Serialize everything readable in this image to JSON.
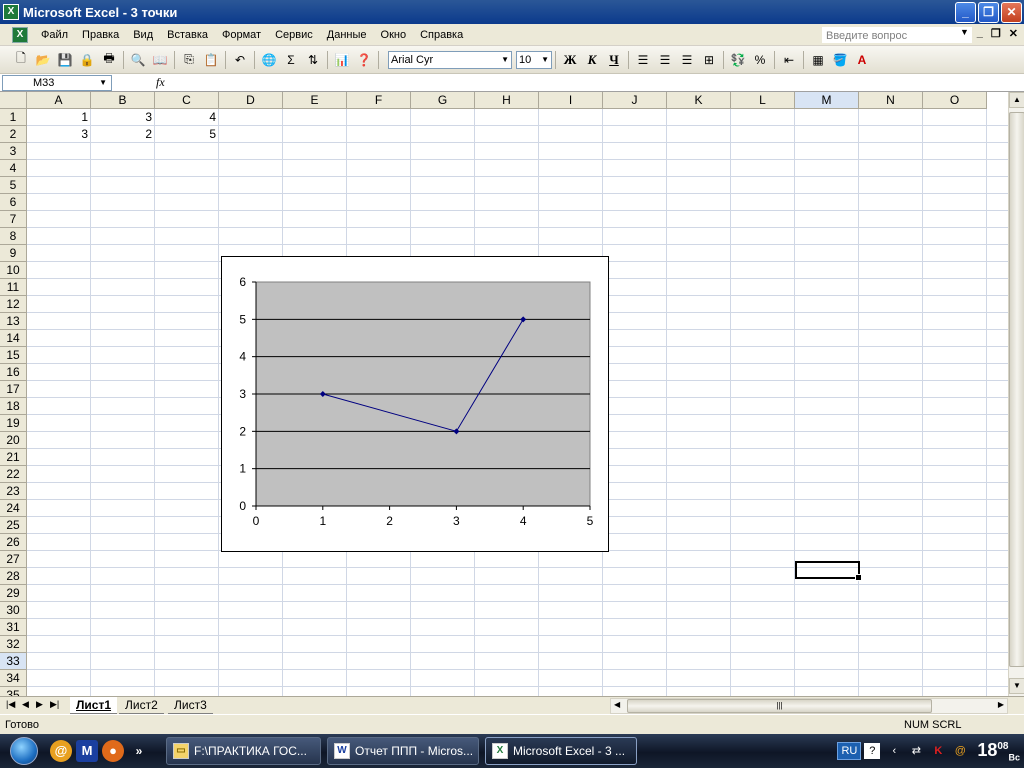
{
  "window": {
    "title": "Microsoft Excel - 3 точки",
    "app_icon": "X"
  },
  "menu": {
    "items": [
      "Файл",
      "Правка",
      "Вид",
      "Вставка",
      "Формат",
      "Сервис",
      "Данные",
      "Окно",
      "Справка"
    ],
    "ask_placeholder": "Введите вопрос"
  },
  "toolbar": {
    "font_name": "Arial Cyr",
    "font_size": "10",
    "bold": "Ж",
    "italic": "К",
    "underline": "Ч",
    "percent": "%",
    "sigma": "Σ"
  },
  "formula_bar": {
    "name_box": "M33",
    "fx": "fx",
    "content": ""
  },
  "columns": [
    "A",
    "B",
    "C",
    "D",
    "E",
    "F",
    "G",
    "H",
    "I",
    "J",
    "K",
    "L",
    "M",
    "N",
    "O"
  ],
  "active_column": "M",
  "active_row": "33",
  "rows": [
    "1",
    "2",
    "3",
    "4",
    "5",
    "6",
    "7",
    "8",
    "9",
    "10",
    "11",
    "12",
    "13",
    "14",
    "15",
    "16",
    "17",
    "18",
    "19",
    "20",
    "21",
    "22",
    "23",
    "24",
    "25",
    "26",
    "27",
    "28",
    "29",
    "30",
    "31",
    "32",
    "33",
    "34",
    "35"
  ],
  "cells": {
    "A1": "1",
    "B1": "3",
    "C1": "4",
    "A2": "3",
    "B2": "2",
    "C2": "5"
  },
  "chart_data": {
    "type": "scatter",
    "series": [
      {
        "x": [
          1,
          3,
          4
        ],
        "y": [
          3,
          2,
          5
        ]
      }
    ],
    "xlim": [
      0,
      5
    ],
    "ylim": [
      0,
      6
    ],
    "x_ticks": [
      "0",
      "1",
      "2",
      "3",
      "4",
      "5"
    ],
    "y_ticks": [
      "0",
      "1",
      "2",
      "3",
      "4",
      "5",
      "6"
    ],
    "grid": "horizontal",
    "plot_background": "#c0c0c0",
    "line_color": "#000080",
    "title": "",
    "xlabel": "",
    "ylabel": ""
  },
  "sheets": {
    "tabs": [
      "Лист1",
      "Лист2",
      "Лист3"
    ],
    "active": "Лист1"
  },
  "status": {
    "left": "Готово",
    "right": "NUM  SCRL"
  },
  "taskbar": {
    "tasks": [
      "F:\\ПРАКТИКА ГОС...",
      "Отчет ППП - Micros...",
      "Microsoft Excel - 3 ..."
    ],
    "lang": "RU",
    "clock": "18",
    "clock_minutes": "08",
    "clock_day": "Вс"
  }
}
